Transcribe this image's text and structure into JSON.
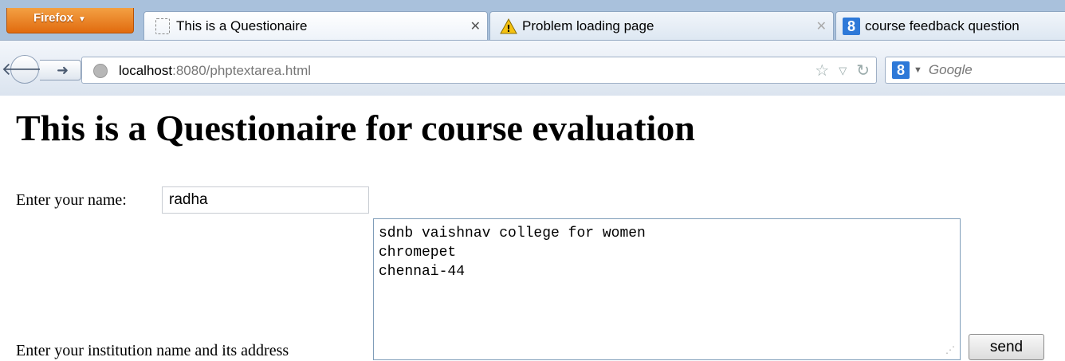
{
  "browser": {
    "app_button": "Firefox",
    "tabs": [
      {
        "label": "This is a Questionaire",
        "icon": "blank-page-icon",
        "active": true
      },
      {
        "label": "Problem loading page",
        "icon": "warning-icon",
        "active": false
      },
      {
        "label": "course feedback question",
        "icon": "google-icon",
        "active": false
      }
    ],
    "url_host": "localhost",
    "url_rest": ":8080/phptextarea.html",
    "search_placeholder": "Google",
    "search_engine_letter": "8"
  },
  "page": {
    "heading": "This is a Questionaire for course evaluation",
    "name_label": "Enter your name:",
    "name_value": "radha",
    "address_label": "Enter your institution name and its address",
    "address_value": "sdnb vaishnav college for women\nchromepet\nchennai-44",
    "send_label": "send"
  },
  "colors": {
    "firefox_orange": "#e16b0f",
    "tabstrip_bg": "#a9c1dc",
    "google_blue": "#2e79d8"
  }
}
